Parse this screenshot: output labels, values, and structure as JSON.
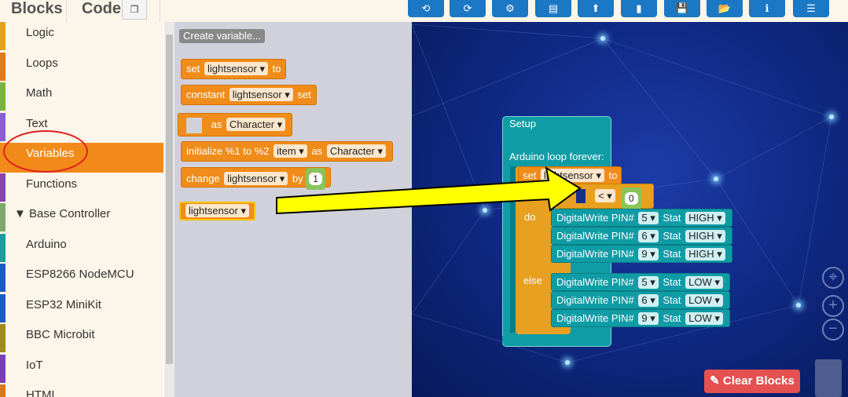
{
  "tabs": {
    "blocks": "Blocks",
    "code": "Code"
  },
  "toolbar": {
    "buttons": [
      {
        "name": "undo",
        "icon": "⟲"
      },
      {
        "name": "redo",
        "icon": "⟳"
      },
      {
        "name": "settings",
        "icon": "⚙"
      },
      {
        "name": "archive",
        "icon": "▤"
      },
      {
        "name": "upload",
        "icon": "⬆"
      },
      {
        "name": "chart",
        "icon": "▮"
      },
      {
        "name": "save",
        "icon": "💾"
      },
      {
        "name": "open-folder",
        "icon": "📂"
      },
      {
        "name": "info",
        "icon": "ℹ"
      },
      {
        "name": "list",
        "icon": "☰"
      }
    ]
  },
  "sidebar": {
    "items": [
      {
        "label": "Logic",
        "color": "#e3a21a"
      },
      {
        "label": "Loops",
        "color": "#e07a1b"
      },
      {
        "label": "Math",
        "color": "#7ab43c"
      },
      {
        "label": "Text",
        "color": "#8b5fd6"
      },
      {
        "label": "Variables",
        "color": "#f28a1a"
      },
      {
        "label": "Functions",
        "color": "#8a44ad"
      },
      {
        "label": "▼ Base Controller",
        "color": "#7ea96a"
      },
      {
        "label": "Arduino",
        "color": "#1a9c9c"
      },
      {
        "label": "ESP8266 NodeMCU",
        "color": "#1a5cc7"
      },
      {
        "label": "ESP32 MiniKit",
        "color": "#1a5cc7"
      },
      {
        "label": "BBC Microbit",
        "color": "#a08c18"
      },
      {
        "label": "IoT",
        "color": "#7a3fb8"
      },
      {
        "label": "HTML",
        "color": "#d97a1a"
      }
    ]
  },
  "flyout": {
    "create_variable": "Create variable...",
    "set": {
      "kw": "set",
      "var": "lightsensor",
      "to": "to"
    },
    "constant": {
      "kw": "constant",
      "var": "lightsensor",
      "set": "set"
    },
    "as_char": {
      "kw": "as",
      "type": "Character"
    },
    "initialize": {
      "kw": "initialize %1 to %2",
      "item": "item",
      "as": "as",
      "type": "Character"
    },
    "change": {
      "kw": "change",
      "var": "lightsensor",
      "by": "by",
      "value": "1"
    },
    "getter": {
      "var": "lightsensor"
    }
  },
  "workspace": {
    "setup_label": "Setup",
    "loop_label": "Arduino loop forever:",
    "set_block": {
      "kw": "set",
      "var": "lightsensor",
      "to": "to"
    },
    "compare": {
      "op": "<",
      "value": "0"
    },
    "do_label": "do",
    "else_label": "else",
    "do_rows": [
      {
        "label": "DigitalWrite PIN#",
        "pin": "5",
        "stat": "Stat",
        "value": "HIGH"
      },
      {
        "label": "DigitalWrite PIN#",
        "pin": "6",
        "stat": "Stat",
        "value": "HIGH"
      },
      {
        "label": "DigitalWrite PIN#",
        "pin": "9",
        "stat": "Stat",
        "value": "HIGH"
      }
    ],
    "else_rows": [
      {
        "label": "DigitalWrite PIN#",
        "pin": "5",
        "stat": "Stat",
        "value": "LOW"
      },
      {
        "label": "DigitalWrite PIN#",
        "pin": "6",
        "stat": "Stat",
        "value": "LOW"
      },
      {
        "label": "DigitalWrite PIN#",
        "pin": "9",
        "stat": "Stat",
        "value": "LOW"
      }
    ],
    "clear_button": "Clear Blocks"
  }
}
